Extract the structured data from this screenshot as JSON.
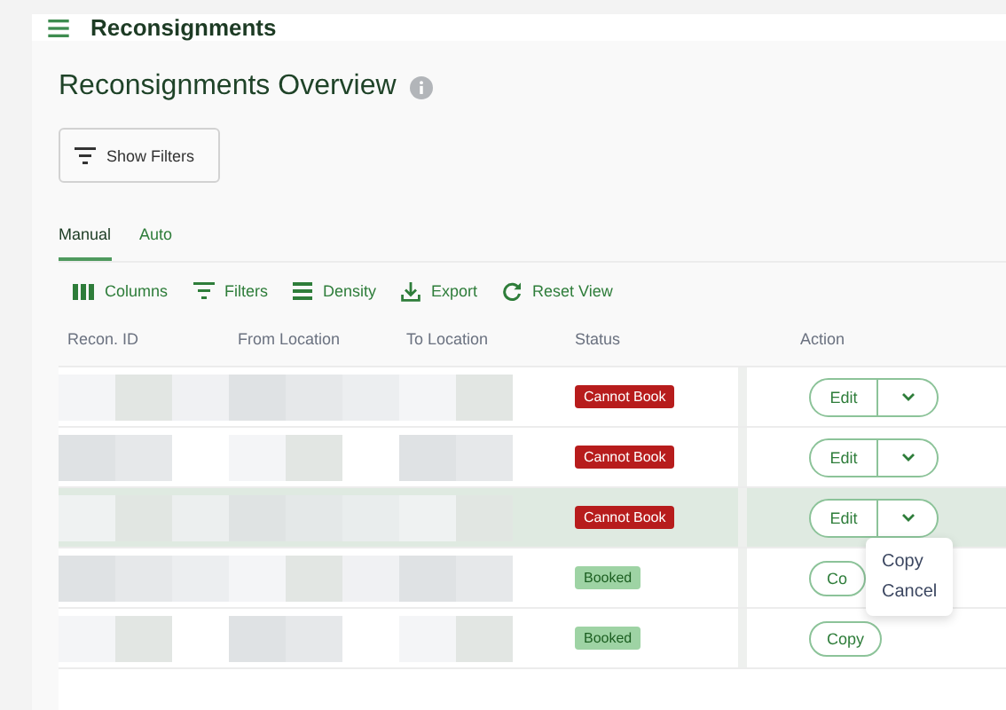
{
  "app_bar": {
    "title": "Reconsignments"
  },
  "page": {
    "title": "Reconsignments Overview"
  },
  "show_filters": {
    "label": "Show Filters"
  },
  "tabs": [
    {
      "label": "Manual",
      "selected": true
    },
    {
      "label": "Auto",
      "selected": false
    }
  ],
  "toolbar": [
    {
      "kind": "columns",
      "label": "Columns"
    },
    {
      "kind": "filters",
      "label": "Filters"
    },
    {
      "kind": "density",
      "label": "Density"
    },
    {
      "kind": "export",
      "label": "Export"
    },
    {
      "kind": "reset",
      "label": "Reset View"
    }
  ],
  "table": {
    "columns": [
      "Recon. ID",
      "From Location",
      "To Location",
      "Status",
      "Action"
    ],
    "rows": [
      {
        "status": "Cannot Book",
        "color": "#b71c1c",
        "kind": "split",
        "action": "Edit",
        "hovered": false
      },
      {
        "status": "Cannot Book",
        "color": "#b71c1c",
        "kind": "split",
        "action": "Edit",
        "hovered": false
      },
      {
        "status": "Cannot Book",
        "color": "#b71c1c",
        "kind": "split",
        "action": "Edit",
        "hovered": true
      },
      {
        "status": "Booked",
        "color": "#9ed3a4",
        "kind": "single",
        "action": "Co",
        "hovered": false
      },
      {
        "status": "Booked",
        "color": "#9ed3a4",
        "kind": "single",
        "action": "Copy",
        "hovered": false
      }
    ]
  },
  "menu": {
    "items": [
      "Copy",
      "Cancel"
    ]
  }
}
